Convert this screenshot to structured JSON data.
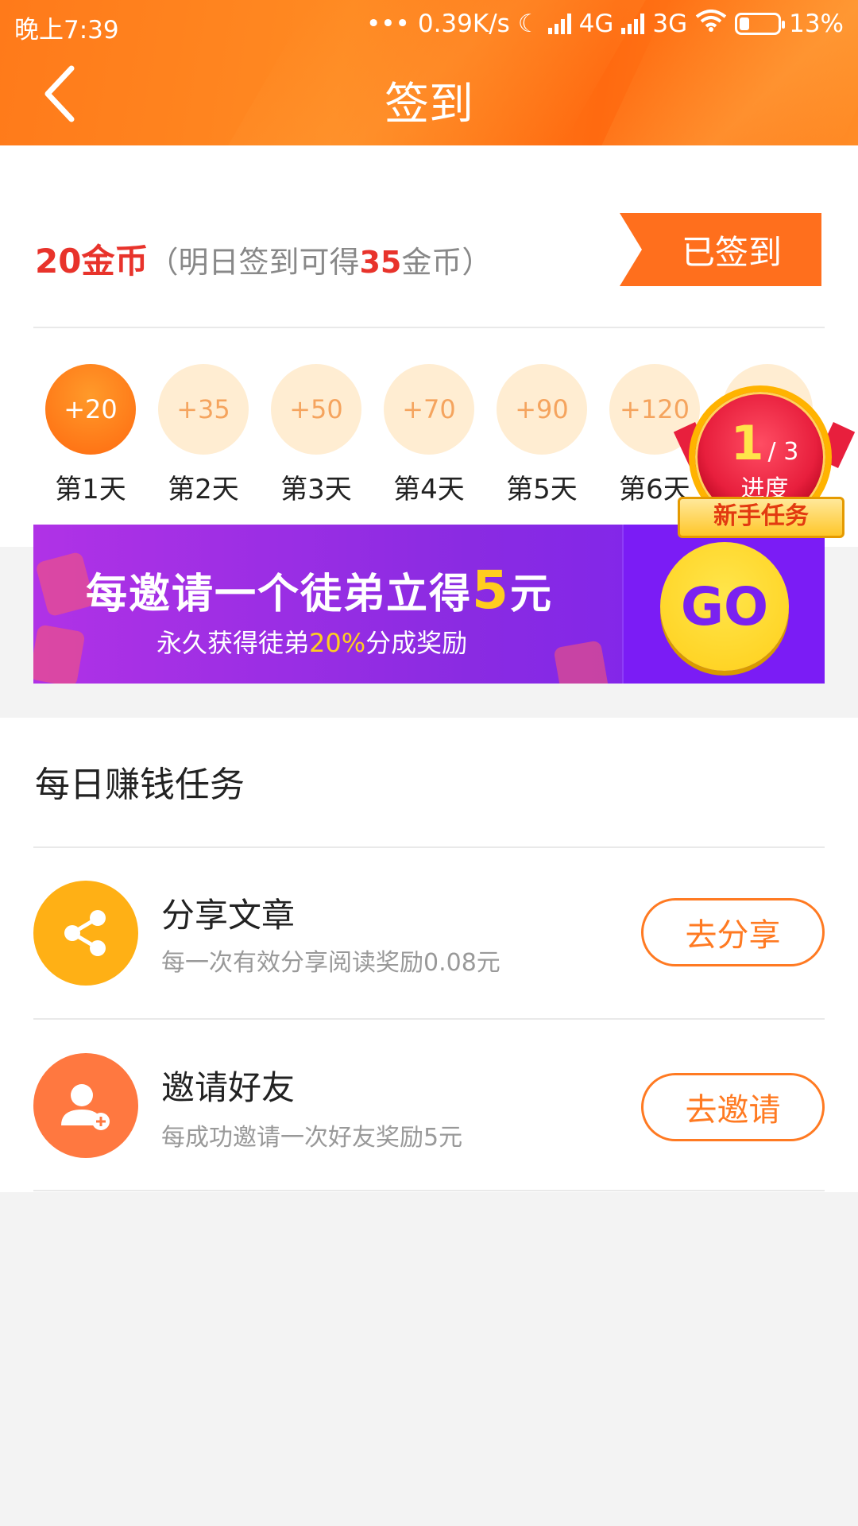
{
  "status_bar": {
    "time": "晚上7:39",
    "speed": "0.39K/s",
    "network1": "4G",
    "network2": "3G",
    "battery": "13%"
  },
  "header": {
    "title": "签到",
    "back_icon": "chevron-left-icon"
  },
  "checkin": {
    "coins": "20金币",
    "hint_prefix": "（明日签到可得",
    "hint_amount": "35",
    "hint_suffix": "金币）",
    "checked_label": "已签到",
    "days": [
      {
        "reward": "+20",
        "label": "第1天",
        "active": true
      },
      {
        "reward": "+35",
        "label": "第2天",
        "active": false
      },
      {
        "reward": "+50",
        "label": "第3天",
        "active": false
      },
      {
        "reward": "+70",
        "label": "第4天",
        "active": false
      },
      {
        "reward": "+90",
        "label": "第5天",
        "active": false
      },
      {
        "reward": "+120",
        "label": "第6天",
        "active": false
      }
    ]
  },
  "badge": {
    "current": "1",
    "total": "/ 3",
    "progress_label": "进度",
    "ribbon": "新手任务"
  },
  "banner": {
    "title_prefix": "每邀请一个徒弟立得",
    "title_amount": "5",
    "title_suffix": "元",
    "sub_prefix": "永久获得徒弟",
    "sub_pct": "20%",
    "sub_suffix": "分成奖励",
    "go_label": "GO"
  },
  "tasks": {
    "section_title": "每日赚钱任务",
    "items": [
      {
        "name": "分享文章",
        "desc": "每一次有效分享阅读奖励0.08元",
        "button": "去分享",
        "icon": "share-icon",
        "color": "#ffb015"
      },
      {
        "name": "邀请好友",
        "desc": "每成功邀请一次好友奖励5元",
        "button": "去邀请",
        "icon": "add-user-icon",
        "color": "#ff7840"
      }
    ]
  }
}
